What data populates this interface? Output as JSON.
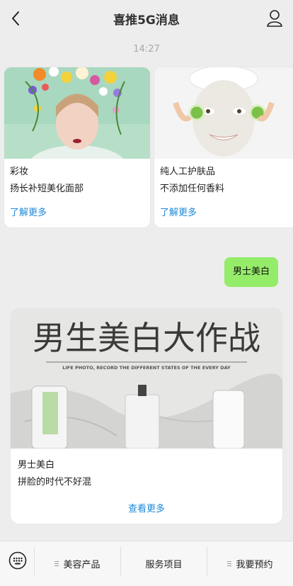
{
  "header": {
    "title": "喜推5G消息",
    "back_icon": "back-arrow-icon",
    "profile_icon": "user-icon"
  },
  "timestamp": "14:27",
  "cards": [
    {
      "title": "彩妆",
      "subtitle": "扬长补短美化面部",
      "link": "了解更多"
    },
    {
      "title": "纯人工护肤品",
      "subtitle": "不添加任何香料",
      "link": "了解更多"
    }
  ],
  "message": {
    "text": "男士美白",
    "bubble_color": "#95ec69"
  },
  "feature_card": {
    "banner_title": "男生美白大作战",
    "banner_subtitle": "LIFE PHOTO, RECORD THE DIFFERENT STATES OF THE EVERY DAY",
    "title": "男士美白",
    "subtitle": "拼脸的时代不好混",
    "link": "查看更多"
  },
  "bottom_menu": {
    "keyboard_icon": "keyboard-icon",
    "items": [
      {
        "label": "美容产品",
        "has_submenu": true
      },
      {
        "label": "服务项目",
        "has_submenu": false
      },
      {
        "label": "我要预约",
        "has_submenu": true
      }
    ]
  },
  "colors": {
    "link": "#1e88d6",
    "background": "#ededed"
  }
}
